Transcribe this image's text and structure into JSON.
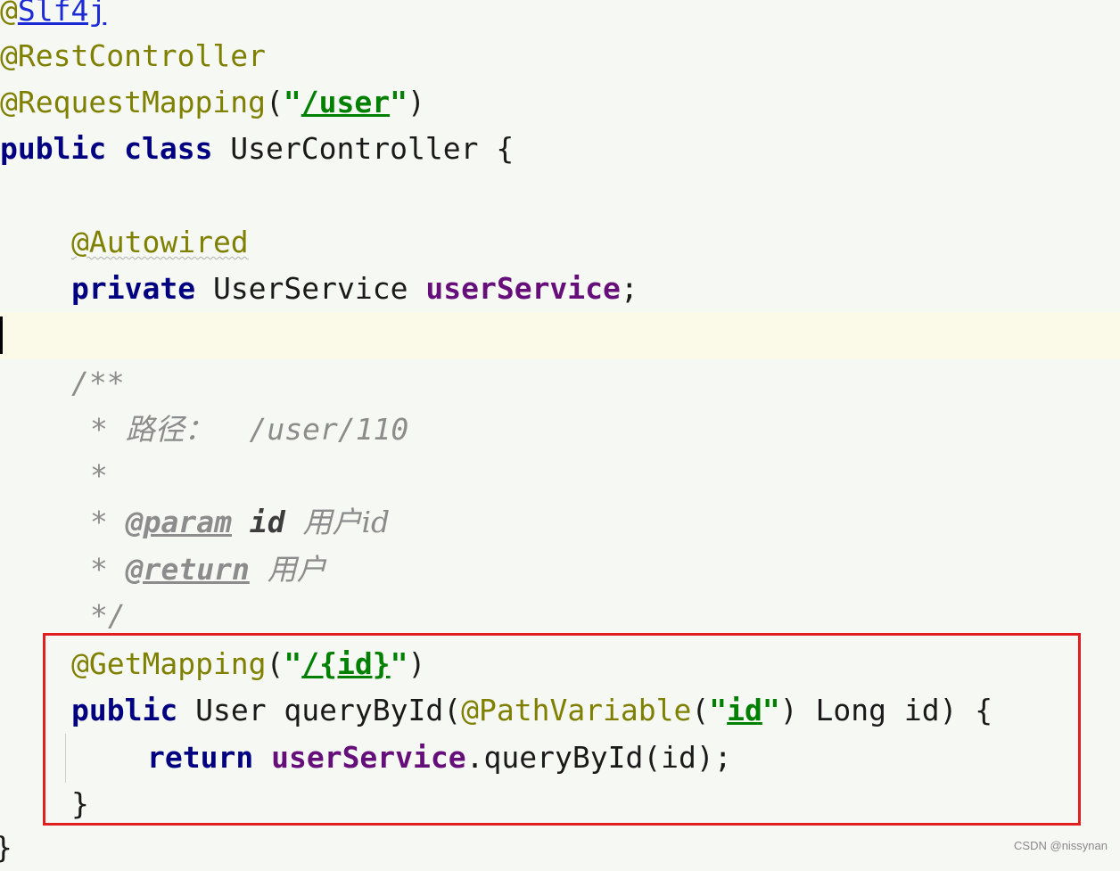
{
  "code": {
    "l1_at": "@",
    "l1_name": "Slf4j",
    "l2": "@RestController",
    "l3_ann": "@RequestMapping",
    "l3_open": "(",
    "l3_q1": "\"",
    "l3_path": "/user",
    "l3_q2": "\"",
    "l3_close": ")",
    "l4_kw1": "public",
    "l4_kw2": "class",
    "l4_rest": " UserController {",
    "l6": "@Autowired",
    "l7_kw": "private",
    "l7_type": " UserService ",
    "l7_field": "userService",
    "l7_end": ";",
    "doc_open": "/**",
    "doc_star": "*",
    "doc_path_label": "路径：",
    "doc_path_value": "  /user/110",
    "doc_param_tag": "@param",
    "doc_param_name": "id",
    "doc_param_desc": "用户id",
    "doc_return_tag": "@return",
    "doc_return_desc": "用户",
    "doc_close": "*/",
    "m1_ann": "@GetMapping",
    "m1_open": "(",
    "m1_q1": "\"",
    "m1_path": "/{id}",
    "m1_q2": "\"",
    "m1_close": ")",
    "m2_kw": "public",
    "m2_type": " User queryById(",
    "m2_ann": "@PathVariable",
    "m2_open": "(",
    "m2_q1": "\"",
    "m2_str": "id",
    "m2_q2": "\"",
    "m2_rest": ") Long id) {",
    "m3_kw": "return",
    "m3_field": "userService",
    "m3_rest": ".queryById(id);",
    "m4": "}",
    "last": "}"
  },
  "watermark": "CSDN @nissynan",
  "colors": {
    "background": "#f6f8f3",
    "annotation": "#808000",
    "keyword": "#000080",
    "string": "#008000",
    "field": "#660e7a",
    "comment": "#8c8c8c",
    "highlight_box": "#e02020"
  }
}
